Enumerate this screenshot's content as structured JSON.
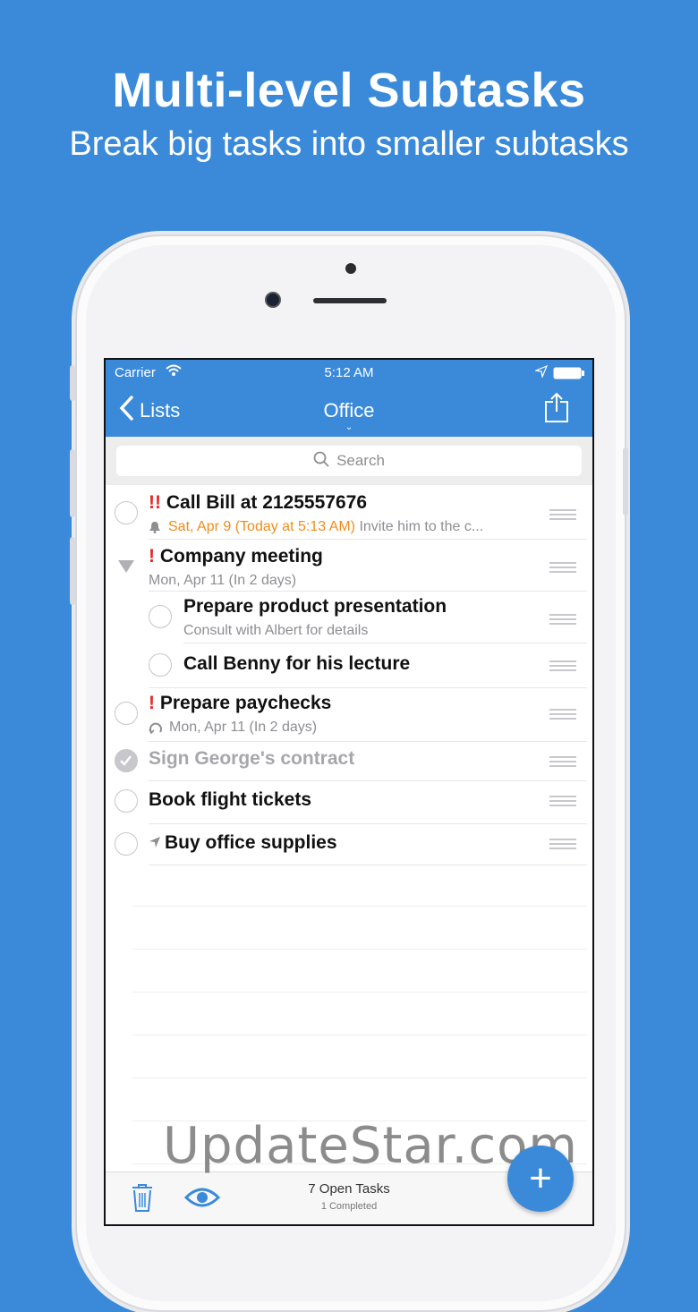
{
  "promo": {
    "title": "Multi-level Subtasks",
    "subtitle": "Break big tasks into smaller subtasks"
  },
  "status_bar": {
    "carrier": "Carrier",
    "time": "5:12 AM"
  },
  "nav": {
    "back_label": "Lists",
    "title": "Office",
    "share_icon": "share-icon"
  },
  "search": {
    "placeholder": "Search"
  },
  "tasks": [
    {
      "priority": "!!",
      "title": "Call Bill at 2125557676",
      "sub_date": "Sat, Apr 9 (Today at 5:13 AM)",
      "sub_note": "Invite him to the c...",
      "icon": "bell-icon"
    },
    {
      "priority": "!",
      "title": "Company meeting",
      "sub": "Mon, Apr 11 (In 2 days)",
      "icon": "disclosure-triangle-icon"
    },
    {
      "title": "Prepare product presentation",
      "sub": "Consult with Albert for details"
    },
    {
      "title": "Call Benny for his lecture"
    },
    {
      "priority": "!",
      "title": "Prepare paychecks",
      "sub": "Mon, Apr 11 (In 2 days)",
      "icon": "repeat-icon"
    },
    {
      "title": "Sign George's contract",
      "completed": true
    },
    {
      "title": "Book flight tickets"
    },
    {
      "title": "Buy office supplies",
      "icon": "location-arrow-icon"
    }
  ],
  "toolbar": {
    "open_tasks": "7 Open Tasks",
    "completed": "1 Completed",
    "add_label": "+"
  },
  "watermark": "UpdateStar.com",
  "colors": {
    "accent": "#3a8ad9",
    "priority": "#e52a2a",
    "reminder": "#f08c1c"
  }
}
